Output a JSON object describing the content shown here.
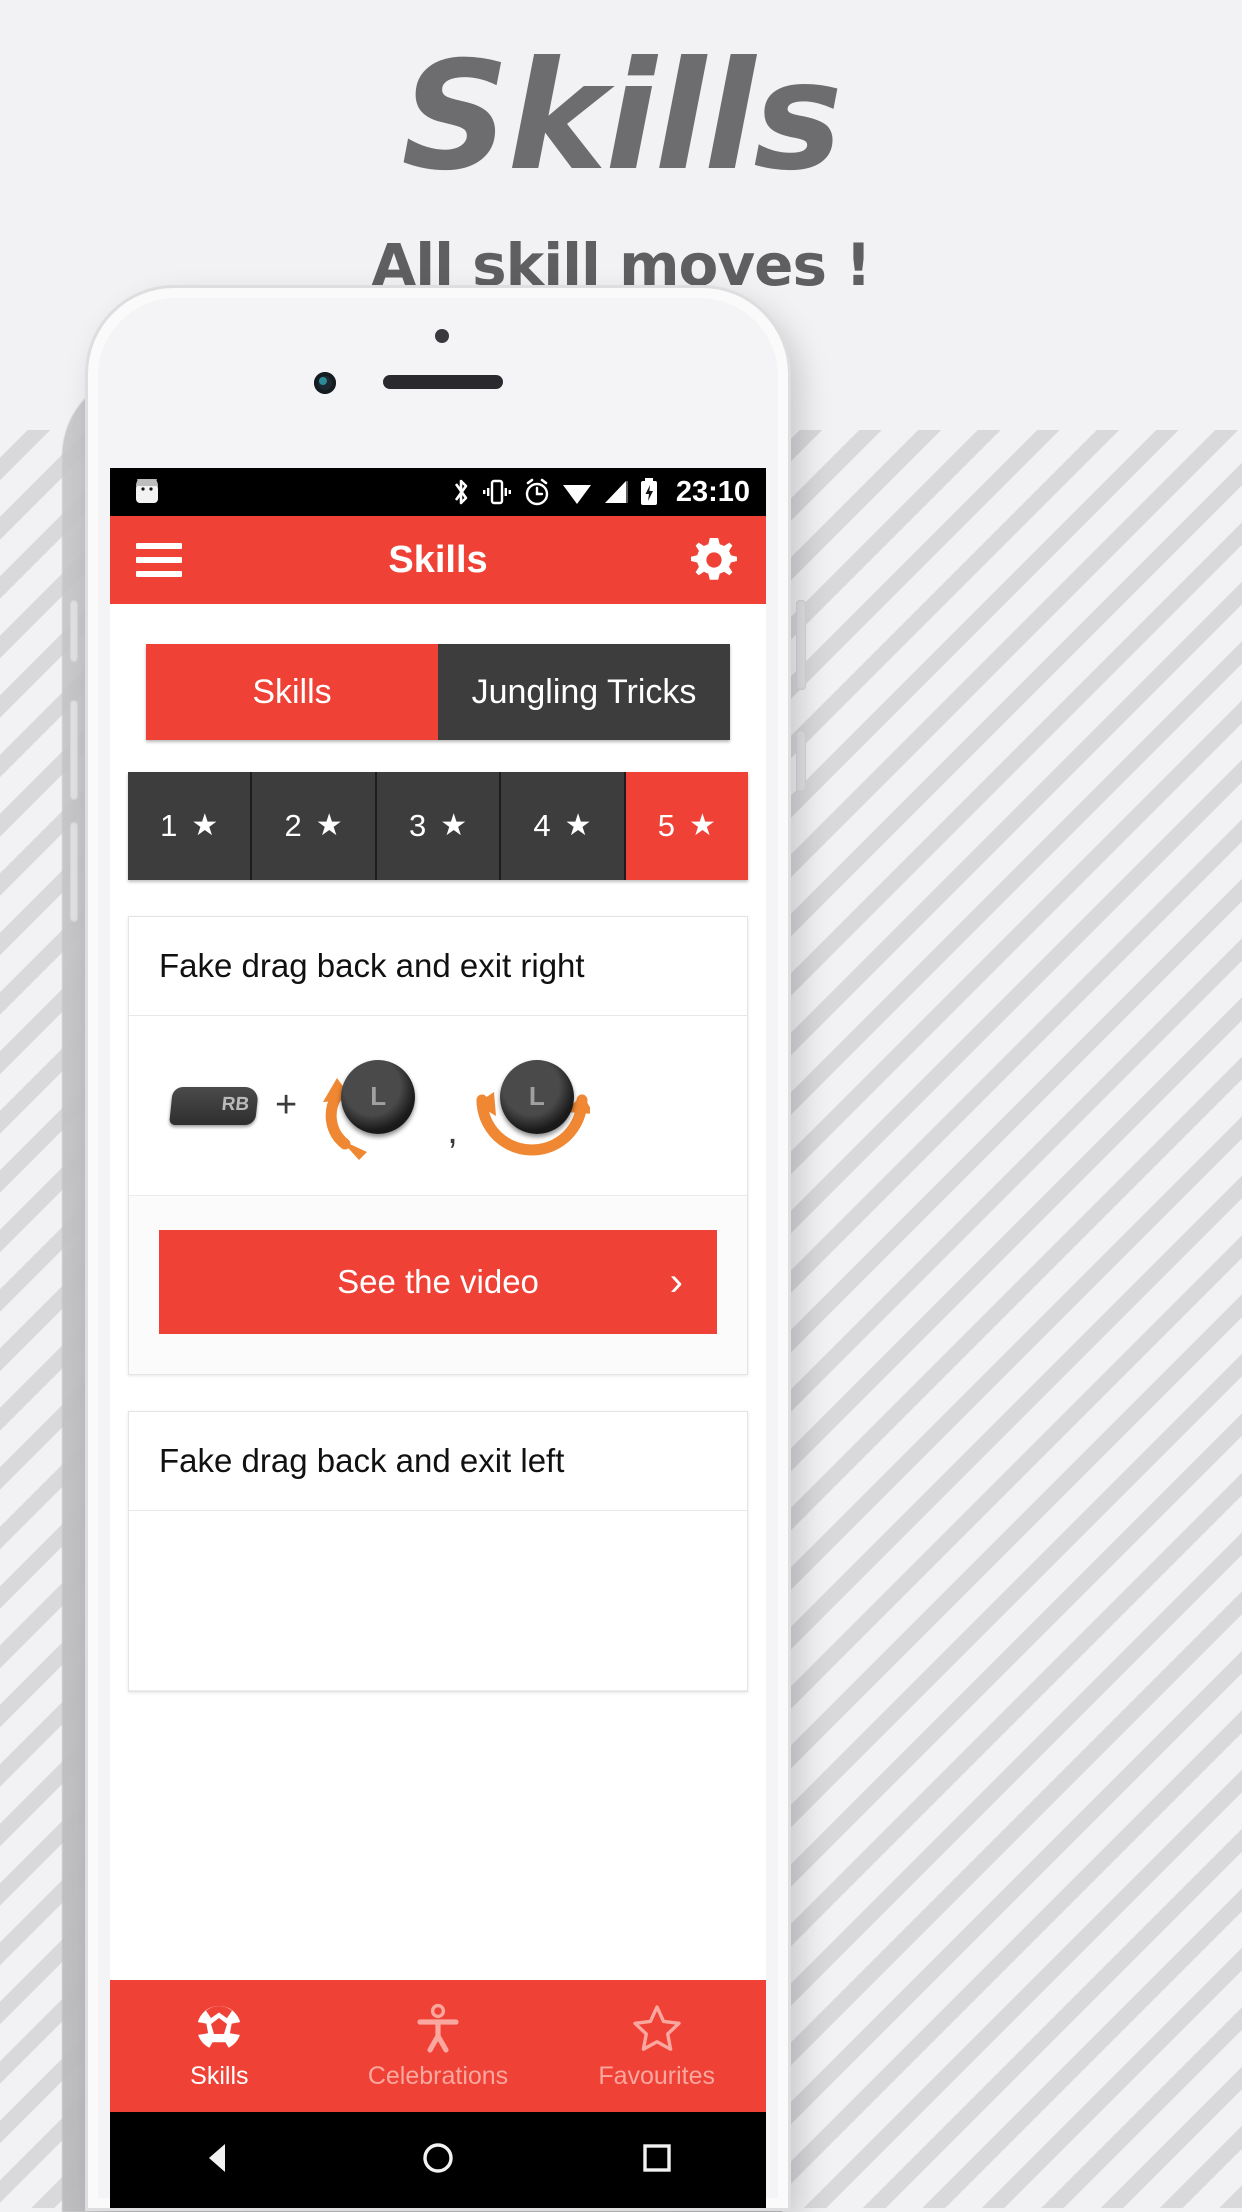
{
  "promo": {
    "title": "Skills",
    "subtitle": "All skill moves !"
  },
  "colors": {
    "accent": "#ef4136",
    "dark": "#3d3d3d",
    "page_bg": "#f2f1f3",
    "title_gray": "#6d6d70",
    "arrow_orange": "#ef8733"
  },
  "statusbar": {
    "time": "23:10",
    "icons": [
      "android-robot-icon",
      "bluetooth-icon",
      "vibrate-icon",
      "alarm-icon",
      "wifi-icon",
      "signal-icon",
      "battery-charging-icon"
    ]
  },
  "appbar": {
    "menu_icon": "hamburger-menu-icon",
    "title": "Skills",
    "settings_icon": "gear-icon"
  },
  "segmented": {
    "tabs": [
      {
        "label": "Skills",
        "selected": true
      },
      {
        "label": "Jungling Tricks",
        "selected": false
      }
    ]
  },
  "difficulty": {
    "items": [
      {
        "label": "1",
        "star": "★",
        "selected": false
      },
      {
        "label": "2",
        "star": "★",
        "selected": false
      },
      {
        "label": "3",
        "star": "★",
        "selected": false
      },
      {
        "label": "4",
        "star": "★",
        "selected": false
      },
      {
        "label": "5",
        "star": "★",
        "selected": true
      }
    ]
  },
  "cards": [
    {
      "title": "Fake drag back and exit right",
      "combo": {
        "bumper_label": "RB",
        "plus": "+",
        "separator": ",",
        "stick1_label": "L",
        "stick2_label": "L"
      },
      "video_button": {
        "label": "See the video",
        "chevron": "›"
      }
    },
    {
      "title": "Fake drag back and exit left"
    }
  ],
  "bottomnav": {
    "items": [
      {
        "label": "Skills",
        "icon": "soccer-ball-icon",
        "active": true
      },
      {
        "label": "Celebrations",
        "icon": "person-celebrating-icon",
        "active": false
      },
      {
        "label": "Favourites",
        "icon": "star-outline-icon",
        "active": false
      }
    ]
  },
  "androidnav": {
    "back": "back-triangle-icon",
    "home": "home-circle-icon",
    "recents": "recents-square-icon"
  }
}
